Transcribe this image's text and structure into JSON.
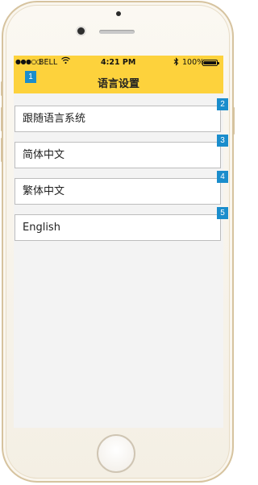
{
  "status_bar": {
    "signal": "●●●○○",
    "carrier": "BELL",
    "time": "4:21 PM",
    "battery": "100%",
    "battery_level": 1.0
  },
  "header": {
    "title": "语言设置",
    "color": "#fdd23c"
  },
  "annotations": [
    "1",
    "2",
    "3",
    "4",
    "5"
  ],
  "languages": [
    {
      "label": "跟随语言系统"
    },
    {
      "label": "简体中文"
    },
    {
      "label": "繁体中文"
    },
    {
      "label": "English"
    }
  ],
  "accent_color": "#1a8dcc"
}
